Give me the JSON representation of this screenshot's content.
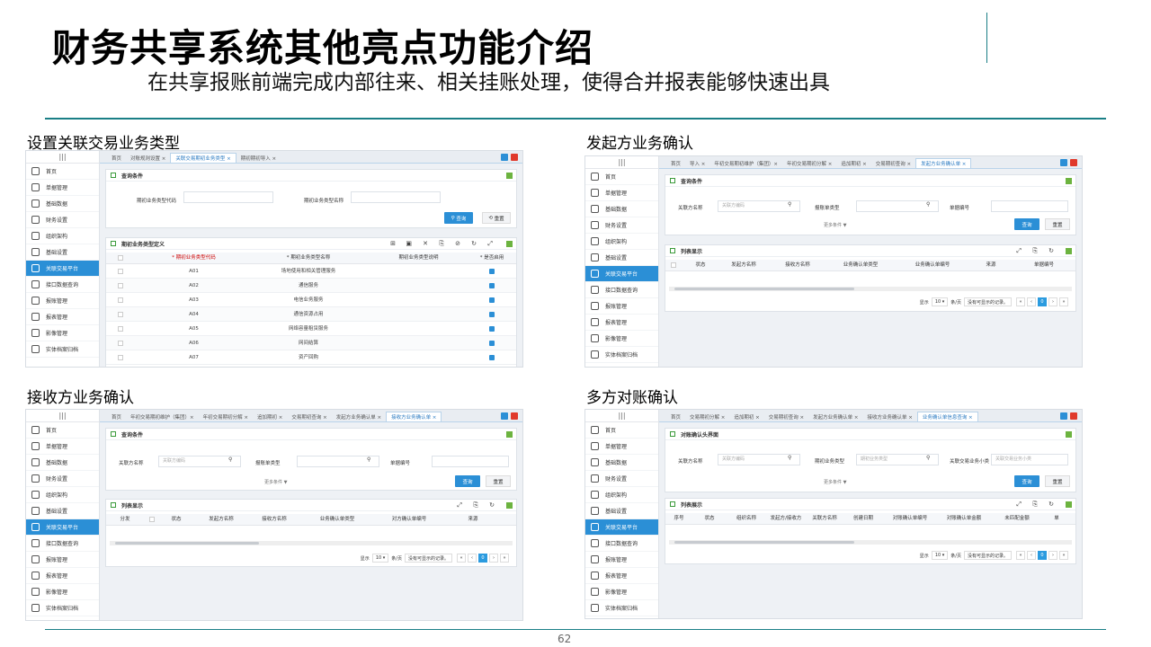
{
  "title": "财务共享系统其他亮点功能介绍",
  "subtitle": "在共享报账前端完成内部往来、相关挂账处理，使得合并报表能够快速出具",
  "page_number": "62",
  "sections": {
    "s1": "设置关联交易业务类型",
    "s2": "发起方业务确认",
    "s3": "接收方业务确认",
    "s4": "多方对账确认"
  },
  "colors": {
    "accent": "#1a7f86",
    "active_blue": "#2b8fd6",
    "panel_green": "#6cb33f"
  },
  "sidebar": {
    "items": [
      "首页",
      "单据管理",
      "基础数据",
      "财务设置",
      "组织架构",
      "基础设置",
      "关联交易平台",
      "接口数据查询",
      "报账管理",
      "报表管理",
      "影像管理",
      "实体档案归档"
    ],
    "icons": [
      "home-icon",
      "document-icon",
      "gear-icon",
      "bank-icon",
      "org-icon",
      "list-icon",
      "platform-icon",
      "book-icon",
      "report-icon",
      "user-icon",
      "image-icon",
      "archive-icon"
    ]
  },
  "s1": {
    "tabs": [
      "首页",
      "对账规则设置 ×",
      "关联交易期初业务类型 ×",
      "期初期初导入 ×"
    ],
    "query_title": "查询条件",
    "f1": "期初业务类型代码",
    "f2": "期初业务类型名称",
    "query": "查询",
    "reset": "重置",
    "table_title": "期初业务类型定义",
    "headers": [
      "* 期初业务类型代码",
      "* 期初业务类型名称",
      "期初业务类型说明",
      "* 是否启用"
    ],
    "rows": [
      [
        "A01",
        "场地使用和相关管理服务"
      ],
      [
        "A02",
        "通信服务"
      ],
      [
        "A03",
        "电信业务服务"
      ],
      [
        "A04",
        "通信资源占用"
      ],
      [
        "A05",
        "网络容量租赁服务"
      ],
      [
        "A06",
        "网间结算"
      ],
      [
        "A07",
        "资产回购"
      ]
    ]
  },
  "s2": {
    "tabs": [
      "首页",
      "导入 ×",
      "年初交易期初维护（集团）×",
      "年初交易期初分解 ×",
      "追加期初 ×",
      "交易期初查询 ×",
      "发起方业务确认单 ×"
    ],
    "query_title": "查询条件",
    "f1": "关联方名称",
    "f1_ph": "关联方编码",
    "f2": "报账单类型",
    "f3": "单据编号",
    "more": "更多条件 ▼",
    "query": "查询",
    "reset": "重置",
    "list_title": "列表显示",
    "headers": [
      "状态",
      "发起方名称",
      "接收方名称",
      "业务确认单类型",
      "业务确认单编号",
      "来源",
      "单据编号"
    ],
    "pager_show": "显示",
    "pager_size": "10",
    "pager_unit": "条/页",
    "pager_empty": "没有可显示的记录。",
    "pager_cur": "0"
  },
  "s3": {
    "tabs": [
      "首页",
      "年初交易期初维护（集团）×",
      "年初交易期初分解 ×",
      "追加期初 ×",
      "交易期初查询 ×",
      "发起方业务确认单 ×",
      "接收方业务确认单 ×"
    ],
    "query_title": "查询条件",
    "f1": "关联方名称",
    "f1_ph": "关联方编码",
    "f2": "报账单类型",
    "f3": "单据编号",
    "more": "更多条件 ▼",
    "query": "查询",
    "reset": "重置",
    "list_title": "列表显示",
    "headers": [
      "分发",
      "状态",
      "发起方名称",
      "接收方名称",
      "业务确认单类型",
      "对方确认单编号",
      "来源"
    ],
    "pager_show": "显示",
    "pager_size": "10",
    "pager_unit": "条/页",
    "pager_empty": "没有可显示的记录。",
    "pager_cur": "0"
  },
  "s4": {
    "tabs": [
      "首页",
      "交易期初分解 ×",
      "追加期初 ×",
      "交易期初查询 ×",
      "发起方业务确认单 ×",
      "接收方业务确认单 ×",
      "业务确认单信息查询 ×"
    ],
    "query_title": "对账确认头界面",
    "f1": "关联方名称",
    "f1_ph": "关联方编码",
    "f2": "期初业务类型",
    "f2_ph": "期初业务类型",
    "f3": "关联交易业务小类",
    "f3_ph": "关联交易业务小类",
    "more": "更多条件 ▼",
    "query": "查询",
    "reset": "重置",
    "list_title": "列表展示",
    "headers": [
      "序号",
      "状态",
      "组织名称",
      "发起方/接收方",
      "关联方名称",
      "创建日期",
      "对账确认单编号",
      "对账确认单金额",
      "未匹配金额",
      "单"
    ],
    "pager_show": "显示",
    "pager_size": "10",
    "pager_unit": "条/页",
    "pager_empty": "没有可显示的记录。",
    "pager_cur": "0"
  }
}
